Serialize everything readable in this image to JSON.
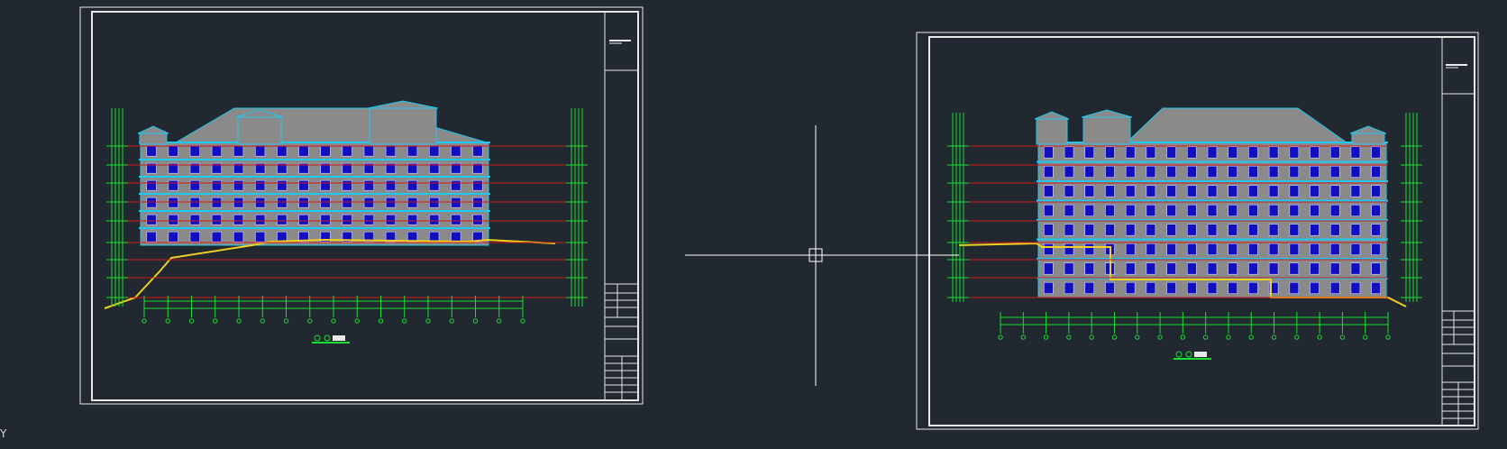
{
  "window": {
    "background": "#212830"
  },
  "viewport": {
    "axis_label": "Y"
  },
  "colors": {
    "frame": "#e8e8e8",
    "dim": "#18e030",
    "level": "#d01818",
    "facade": "#8a8a8a",
    "cyan": "#1ec8f0",
    "window": "#1010c0",
    "ground": "#f0d020",
    "crosshair": "#ffffff"
  },
  "crosshair": {
    "type": "pickbox"
  },
  "sheets": [
    {
      "name": "left-elevation-sheet",
      "title_block": true,
      "bays": 16,
      "floors": 6,
      "roof": "mansard"
    },
    {
      "name": "right-elevation-sheet",
      "title_block": true,
      "bays": 17,
      "floors": 8,
      "roof": "hipped"
    }
  ]
}
